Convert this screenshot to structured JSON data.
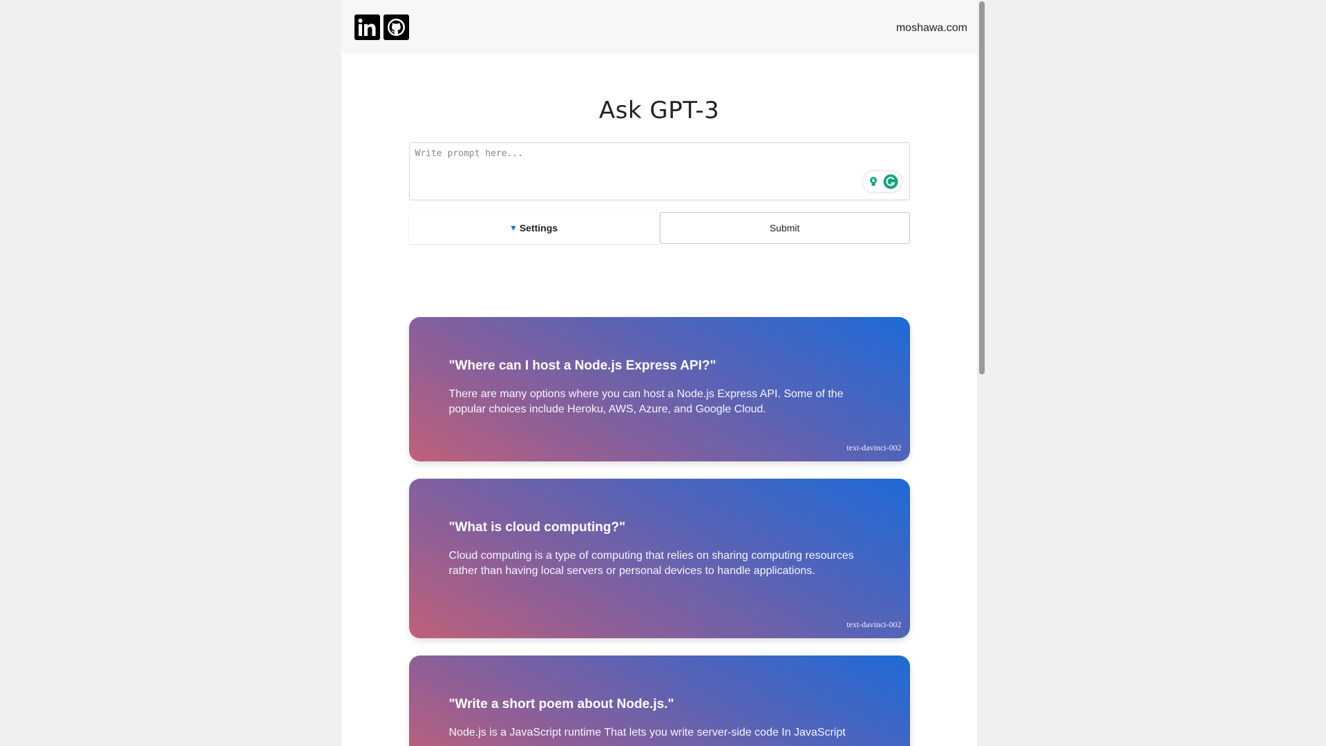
{
  "header": {
    "social": [
      {
        "icon": "linkedin-icon"
      },
      {
        "icon": "github-icon"
      }
    ],
    "site_link": "moshawa.com"
  },
  "main": {
    "title": "Ask GPT-3",
    "prompt_placeholder": "Write prompt here...",
    "settings_label": "Settings",
    "submit_label": "Submit"
  },
  "results": [
    {
      "question": "\"Where can I host a Node.js Express API?\"",
      "answer": "There are many options where you can host a Node.js Express API. Some of the popular choices include Heroku, AWS, Azure, and Google Cloud.",
      "model": "text-davinci-002"
    },
    {
      "question": "\"What is cloud computing?\"",
      "answer": "Cloud computing is a type of computing that relies on sharing computing resources rather than having local servers or personal devices to handle applications.",
      "model": "text-davinci-002"
    },
    {
      "question": "\"Write a short poem about Node.js.\"",
      "answer": "Node.js is a JavaScript runtime That lets you write server-side code In JavaScript"
    }
  ],
  "colors": {
    "accent": "#1a73e8",
    "card_gradient_start": "#c0607a",
    "card_gradient_end": "#1e6ad8",
    "assist_icon": "#15a380"
  }
}
